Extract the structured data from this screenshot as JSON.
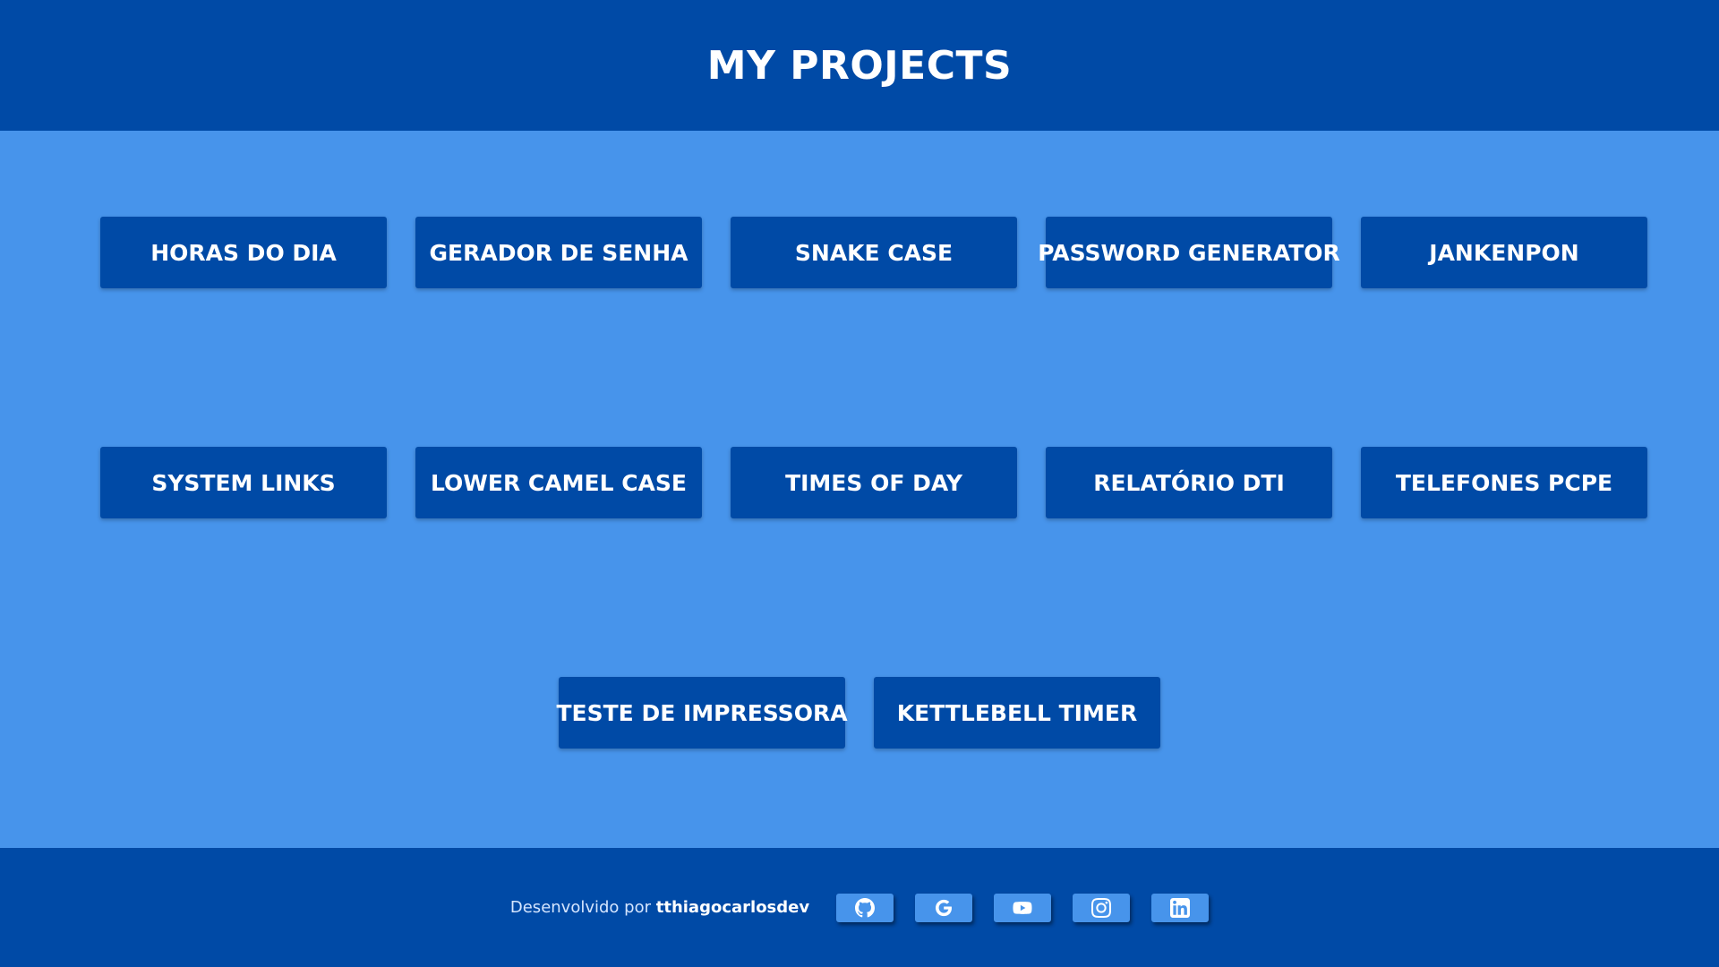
{
  "header": {
    "title": "MY PROJECTS"
  },
  "projects": [
    {
      "label": "HORAS DO DIA"
    },
    {
      "label": "GERADOR DE SENHA"
    },
    {
      "label": "SNAKE CASE"
    },
    {
      "label": "PASSWORD GENERATOR"
    },
    {
      "label": "JANKENPON"
    },
    {
      "label": "SYSTEM LINKS"
    },
    {
      "label": "LOWER CAMEL CASE"
    },
    {
      "label": "TIMES OF DAY"
    },
    {
      "label": "RELATÓRIO DTI"
    },
    {
      "label": "TELEFONES PCPE"
    },
    {
      "label": "TESTE DE IMPRESSORA"
    },
    {
      "label": "KETTLEBELL TIMER"
    }
  ],
  "footer": {
    "credit_prefix": "Desenvolvido por",
    "credit_author": "tthiagocarlosdev",
    "social": [
      {
        "icon": "github-icon"
      },
      {
        "icon": "google-icon"
      },
      {
        "icon": "youtube-icon"
      },
      {
        "icon": "instagram-icon"
      },
      {
        "icon": "linkedin-icon"
      }
    ]
  },
  "colors": {
    "header_bg": "#004aa6",
    "main_bg": "#4794eb",
    "button_bg": "#004aa6",
    "social_button_bg": "#4794eb"
  }
}
